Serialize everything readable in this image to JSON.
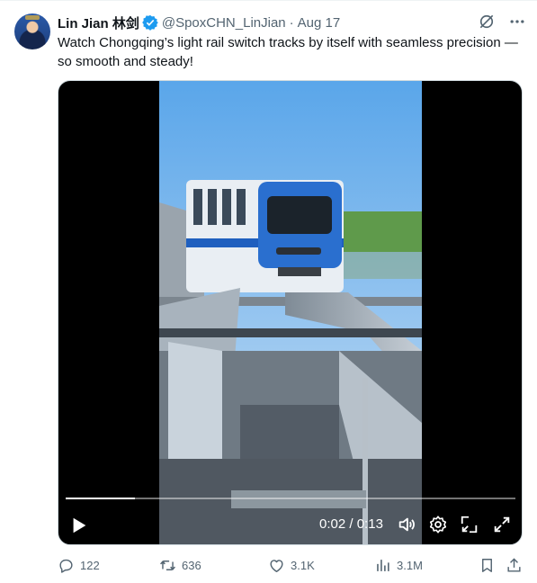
{
  "author": {
    "display_name": "Lin Jian 林剑",
    "handle": "@SpoxCHN_LinJian",
    "separator": "·",
    "date": "Aug 17"
  },
  "tweet": {
    "text": "Watch Chongqing’s light rail switch tracks by itself with seamless precision — so smooth and steady!"
  },
  "video": {
    "time_current": "0:02",
    "time_separator": "/",
    "time_total": "0:13",
    "progress_fraction": 0.154
  },
  "actions": {
    "replies": "122",
    "reposts": "636",
    "likes": "3.1K",
    "views": "3.1M"
  },
  "colors": {
    "accent": "#1d9bf0",
    "text_secondary": "#536471"
  },
  "icons": [
    "verified-badge-icon",
    "grok-icon",
    "more-icon",
    "play-icon",
    "volume-icon",
    "settings-icon",
    "pip-icon",
    "fullscreen-icon",
    "reply-icon",
    "repost-icon",
    "like-icon",
    "views-icon",
    "bookmark-icon",
    "share-icon"
  ]
}
